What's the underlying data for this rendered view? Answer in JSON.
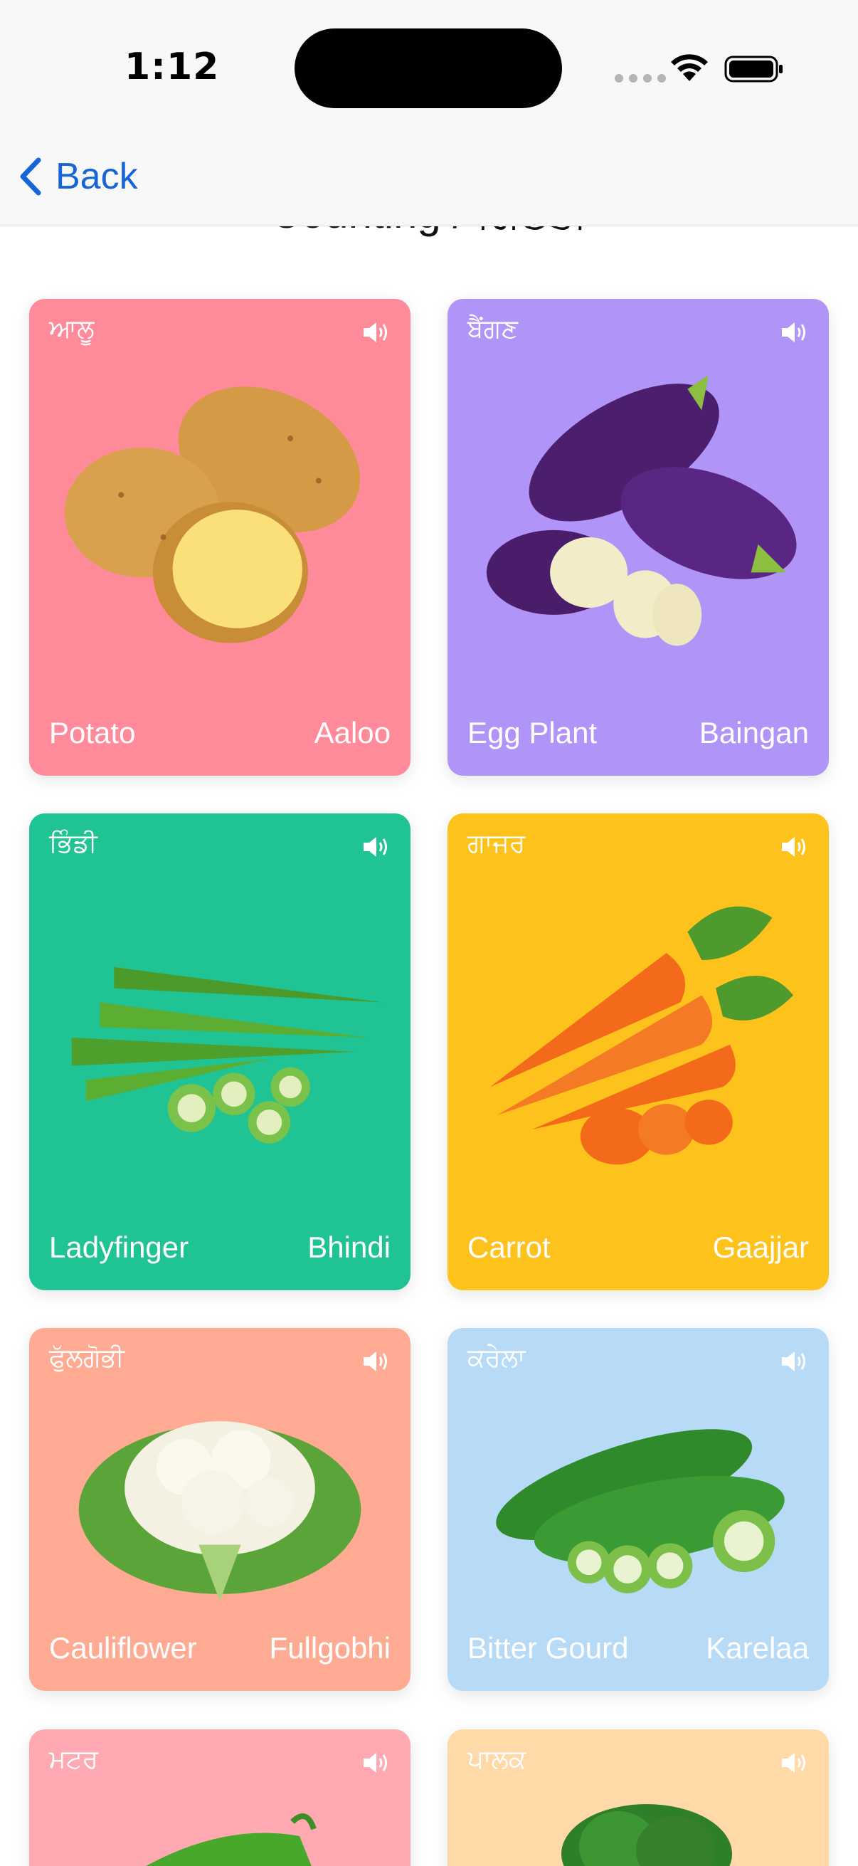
{
  "status": {
    "time": "1:12"
  },
  "nav": {
    "back_label": "Back",
    "title": "Counting / ਗਿਣਤੀ"
  },
  "colors": {
    "pink": "#ff8a9a",
    "purple": "#b094f7",
    "green": "#20c393",
    "yellow": "#fdc21b",
    "salmon": "#ffab94",
    "lightblue": "#b7dbf6",
    "rose": "#ffaab2",
    "peach": "#ffd9a8",
    "accent": "#1565d8"
  },
  "cards": [
    {
      "native": "ਆਲੂ",
      "english": "Potato",
      "translit": "Aaloo",
      "icon": "potato-image"
    },
    {
      "native": "ਬੈਂਗਣ",
      "english": "Egg Plant",
      "translit": "Baingan",
      "icon": "eggplant-image"
    },
    {
      "native": "ਭਿੰਡੀ",
      "english": "Ladyfinger",
      "translit": "Bhindi",
      "icon": "okra-image"
    },
    {
      "native": "ਗਾਜਰ",
      "english": "Carrot",
      "translit": "Gaajjar",
      "icon": "carrot-image"
    },
    {
      "native": "ਫੁੱਲਗੋਭੀ",
      "english": "Cauliflower",
      "translit": "Fullgobhi",
      "icon": "cauliflower-image"
    },
    {
      "native": "ਕਰੇਲਾ",
      "english": "Bitter Gourd",
      "translit": "Karelaa",
      "icon": "bitter-gourd-image"
    },
    {
      "native": "ਮਟਰ",
      "english": "",
      "translit": "",
      "icon": "peas-image"
    },
    {
      "native": "ਪਾਲਕ",
      "english": "",
      "translit": "",
      "icon": "spinach-image"
    }
  ]
}
